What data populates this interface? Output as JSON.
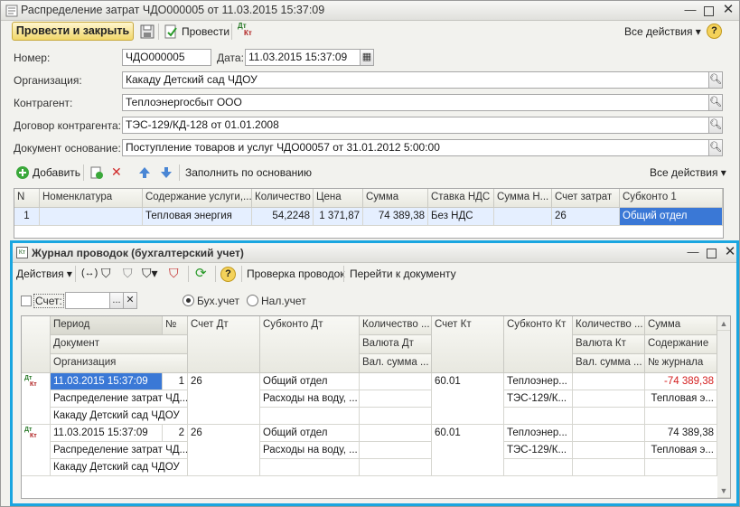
{
  "window": {
    "title": "Распределение затрат ЧДО000005 от 11.03.2015 15:37:09",
    "min_icon": "minimize-icon",
    "max_icon": "maximize-icon",
    "close_icon": "close-icon"
  },
  "toolbar": {
    "post_close": "Провести и закрыть",
    "post": "Провести",
    "dt_kt_top": "Дт",
    "dt_kt_bottom": "Кт",
    "all_actions": "Все действия",
    "help": "?"
  },
  "form": {
    "number_label": "Номер:",
    "number_value": "ЧДО000005",
    "date_label": "Дата:",
    "date_value": "11.03.2015 15:37:09",
    "org_label": "Организация:",
    "org_value": "Какаду Детский сад ЧДОУ",
    "counterparty_label": "Контрагент:",
    "counterparty_value": "Теплоэнергосбыт ООО",
    "contract_label": "Договор контрагента:",
    "contract_value": "ТЭС-129/КД-128 от 01.01.2008",
    "basis_label": "Документ основание:",
    "basis_value": "Поступление товаров и услуг ЧДО00057 от 31.01.2012 5:00:00"
  },
  "table_toolbar": {
    "add": "Добавить",
    "fill": "Заполнить по основанию",
    "all_actions": "Все действия"
  },
  "table": {
    "headers": [
      "N",
      "Номенклатура",
      "Содержание услуги,...",
      "Количество",
      "Цена",
      "Сумма",
      "Ставка НДС",
      "Сумма Н...",
      "Счет затрат",
      "Субконто 1"
    ],
    "rows": [
      [
        "1",
        "",
        "Тепловая энергия",
        "54,2248",
        "1 371,87",
        "74 389,38",
        "Без НДС",
        "",
        "26",
        "Общий отдел"
      ]
    ]
  },
  "journal": {
    "title": "Журнал проводок (бухгалтерский учет)",
    "actions": "Действия",
    "check": "Проверка проводок",
    "goto": "Перейти к документу",
    "help": "?",
    "account_label": "Счет:",
    "account_value": "",
    "ellipsis": "...",
    "clear": "✕",
    "radio_buh": "Бух.учет",
    "radio_nal": "Нал.учет",
    "headers": {
      "period": "Период",
      "num": "№",
      "document": "Документ",
      "organization": "Организация",
      "dt_account": "Счет Дт",
      "dt_subconto": "Субконто Дт",
      "dt_qty": "Количество ...",
      "dt_currency": "Валюта Дт",
      "dt_cur_sum": "Вал. сумма ...",
      "kt_account": "Счет Кт",
      "kt_subconto": "Субконто Кт",
      "kt_qty": "Количество ...",
      "kt_currency": "Валюта Кт",
      "kt_cur_sum": "Вал. сумма ...",
      "sum": "Сумма",
      "content": "Содержание",
      "journal_no": "№ журнала"
    },
    "rows": [
      {
        "dt": "Дт",
        "kt": "Кт",
        "period": "11.03.2015 15:37:09",
        "num": "1",
        "document": "Распределение затрат ЧД...",
        "organization": "Какаду Детский сад ЧДОУ",
        "dt_account": "26",
        "dt_sub1": "Общий отдел",
        "dt_sub2": "Расходы на воду, ...",
        "kt_account": "60.01",
        "kt_sub1": "Теплоэнер...",
        "kt_sub2": "ТЭС-129/К...",
        "sum": "-74 389,38",
        "content": "Тепловая э...",
        "sum_color": "#d42020"
      },
      {
        "dt": "Дт",
        "kt": "Кт",
        "period": "11.03.2015 15:37:09",
        "num": "2",
        "document": "Распределение затрат ЧД...",
        "organization": "Какаду Детский сад ЧДОУ",
        "dt_account": "26",
        "dt_sub1": "Общий отдел",
        "dt_sub2": "Расходы на воду, ...",
        "kt_account": "60.01",
        "kt_sub1": "Теплоэнер...",
        "kt_sub2": "ТЭС-129/К...",
        "sum": "74 389,38",
        "content": "Тепловая э...",
        "sum_color": "#1a1a1a"
      }
    ]
  },
  "colors": {
    "accent_border": "#1aa6e0",
    "selected_row": "#e5efff",
    "selected_cell": "#3a78d6"
  }
}
